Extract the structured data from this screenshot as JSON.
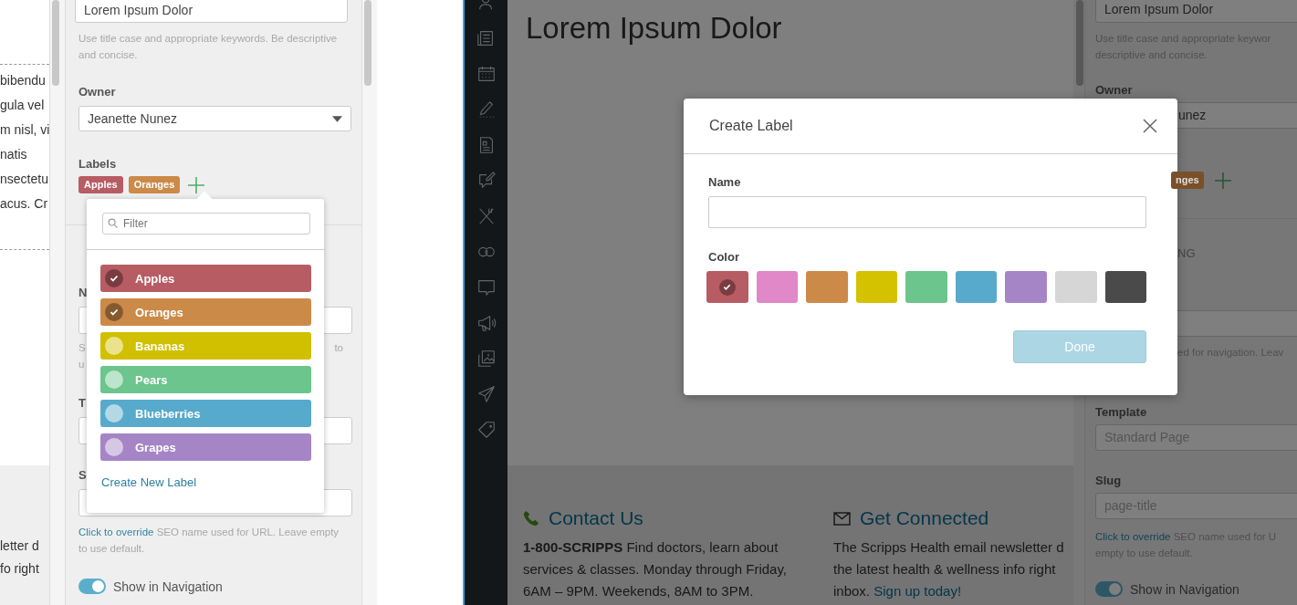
{
  "left_page": {
    "lines": [
      "bibendu",
      "gula vel",
      "m nisl, vi",
      "natis",
      "nsectetu",
      "acus. Cr"
    ],
    "footer_lines": [
      "letter d",
      "fo right"
    ]
  },
  "left_settings": {
    "title_value": "Lorem Ipsum Dolor",
    "title_hint": "Use title case and appropriate keywords. Be descriptive and concise.",
    "owner_label": "Owner",
    "owner_value": "Jeanette Nunez",
    "labels_label": "Labels",
    "tags": [
      {
        "text": "Apples",
        "color": "#b85c64"
      },
      {
        "text": "Oranges",
        "color": "#cc8a48"
      }
    ],
    "field_1_label": "N",
    "field_1_hint_left": [
      "S",
      "u"
    ],
    "field_1_hint_right": "to",
    "field_2_label": "T",
    "field_3_label": "S",
    "slug_hint_link": "Click to override",
    "slug_hint_text": "SEO name used for URL. Leave empty to use default.",
    "nav_toggle": {
      "label": "Show in Navigation",
      "on": true
    }
  },
  "label_dropdown": {
    "filter_placeholder": "Filter",
    "options": [
      {
        "name": "Apples",
        "color": "#b85c64",
        "checked": true
      },
      {
        "name": "Oranges",
        "color": "#cc8a48",
        "checked": true
      },
      {
        "name": "Bananas",
        "color": "#d0c000",
        "checked": false
      },
      {
        "name": "Pears",
        "color": "#6cc58c",
        "checked": false
      },
      {
        "name": "Blueberries",
        "color": "#57aacb",
        "checked": false
      },
      {
        "name": "Grapes",
        "color": "#a585c6",
        "checked": false
      }
    ],
    "create_link": "Create New Label"
  },
  "cms": {
    "heading": "Lorem Ipsum Dolor",
    "contact": {
      "title": "Contact Us",
      "text": "**1-800-SCRIPPS** Find doctors, learn about services & classes. Monday through Friday, 6AM – 9PM. Weekends, 8AM to 3PM."
    },
    "connect": {
      "title": "Get Connected",
      "lines": [
        "The Scripps Health email newsletter d",
        "the latest health & wellness info right"
      ],
      "last_line_text": "inbox.",
      "link": "Sign up today!"
    }
  },
  "right_settings": {
    "title_value": "Lorem Ipsum Dolor",
    "title_hint_lines": [
      "Use title case and appropriate keywor",
      "descriptive and concise."
    ],
    "owner_label": "Owner",
    "owner_value": "unez",
    "tags": [
      {
        "text": "nges",
        "color": "#7a5028"
      }
    ],
    "section_fragment": "NG",
    "nav_hint_fragment": "ed for navigation. Leav",
    "template_label": "Template",
    "template_placeholder": "Standard Page",
    "slug_label": "Slug",
    "slug_placeholder": "page-title",
    "slug_hint_link": "Click to override",
    "slug_hint_lines": [
      "SEO name used for U",
      "empty to use default."
    ],
    "nav_toggle": {
      "label": "Show in Navigation",
      "on": true
    }
  },
  "modal": {
    "title": "Create Label",
    "name_label": "Name",
    "color_label": "Color",
    "swatches": [
      {
        "color": "#b85c64",
        "selected": true
      },
      {
        "color": "#e088c8",
        "selected": false
      },
      {
        "color": "#cc8a48",
        "selected": false
      },
      {
        "color": "#d4c200",
        "selected": false
      },
      {
        "color": "#6cc58c",
        "selected": false
      },
      {
        "color": "#57aacb",
        "selected": false
      },
      {
        "color": "#a585c6",
        "selected": false
      },
      {
        "color": "#d6d6d6",
        "selected": false
      },
      {
        "color": "#4a4a4a",
        "selected": false
      }
    ],
    "done": "Done",
    "done_disabled": true
  }
}
